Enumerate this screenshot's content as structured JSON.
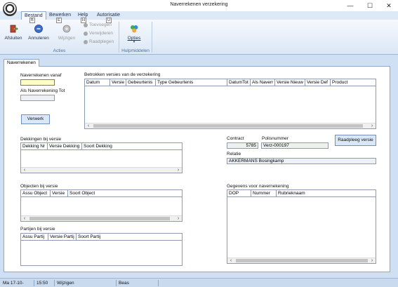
{
  "window": {
    "title": "Naverrekenen verzekering"
  },
  "ribbon": {
    "tabs": [
      "Bestand",
      "Bewerken",
      "Help",
      "Autorisatie"
    ],
    "keytips": [
      "B",
      "E",
      "H",
      "U"
    ],
    "buttons": {
      "afsluiten": "Afsluiten",
      "annuleren": "Annuleren",
      "wijzigen": "Wijzigen",
      "toevoegen": "Toevoegen",
      "verwijderen": "Verwijderen",
      "raadplegen": "Raadplegen",
      "opties": "Opties"
    },
    "groups": {
      "acties": "Acties",
      "hulpmiddelen": "Hulpmiddelen"
    }
  },
  "document_tab": "Naverrekenen",
  "form": {
    "naverrekenen_vanaf_label": "Naverrekenen vanaf",
    "naverrekenen_vanaf_value": "",
    "als_naverrekening_tot_label": "Als Naverrekening Tot",
    "als_naverrekening_tot_value": "",
    "verwerk_button": "Verwerk",
    "contract_label": "Contract",
    "contract_value": "5785",
    "polisnummer_label": "Polisnummer",
    "polisnummer_value": "Verz-000197",
    "raadpleeg_button": "Raadpleeg versie",
    "relatie_label": "Relatie",
    "relatie_value": "AKKERMANS Bosingkamp"
  },
  "grids": {
    "versies": {
      "title": "Betrokken versies van de verzekering",
      "columns": [
        "Datum",
        "Versie",
        "Gebeurtenis",
        "Type Gebeurtenis",
        "DatumTot",
        "Als Naverr",
        "Versie Nieuw",
        "Versie Def",
        "Product"
      ]
    },
    "dekkingen": {
      "title": "Dekkingen bij versie",
      "columns": [
        "Dekking Nr",
        "Versie Dekking",
        "Soort Dekking"
      ]
    },
    "objecten": {
      "title": "Objecten bij versie",
      "columns": [
        "Assu Object",
        "Versie",
        "Soort Object"
      ]
    },
    "partijen": {
      "title": "Partijen bij versie",
      "columns": [
        "Assu Partij",
        "Versie Partij",
        "Soort Partij"
      ]
    },
    "gegevens": {
      "title": "Gegevens voor navernekening",
      "columns": [
        "DOP",
        "Nummer",
        "Rubrieknaam"
      ]
    }
  },
  "statusbar": {
    "date": "Ma 17-10-2022",
    "time": "15:50",
    "mode": "Wijzigen",
    "user": "Beas"
  }
}
